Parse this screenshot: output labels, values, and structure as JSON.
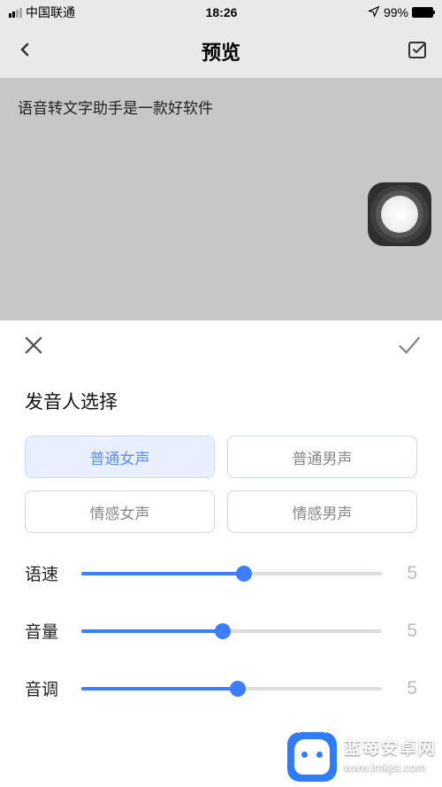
{
  "status": {
    "carrier": "中国联通",
    "time": "18:26",
    "battery": "99%"
  },
  "nav": {
    "title": "预览"
  },
  "content": {
    "text": "语音转文字助手是一款好软件"
  },
  "sheet": {
    "title": "发音人选择",
    "voices": [
      {
        "label": "普通女声",
        "active": true
      },
      {
        "label": "普通男声",
        "active": false
      },
      {
        "label": "情感女声",
        "active": false
      },
      {
        "label": "情感男声",
        "active": false
      }
    ],
    "sliders": [
      {
        "label": "语速",
        "value": "5",
        "percent": 54
      },
      {
        "label": "音量",
        "value": "5",
        "percent": 47
      },
      {
        "label": "音调",
        "value": "5",
        "percent": 52
      }
    ]
  },
  "watermark": {
    "line1": "蓝苺安卓网",
    "line2": "www.lmkjst.com"
  }
}
